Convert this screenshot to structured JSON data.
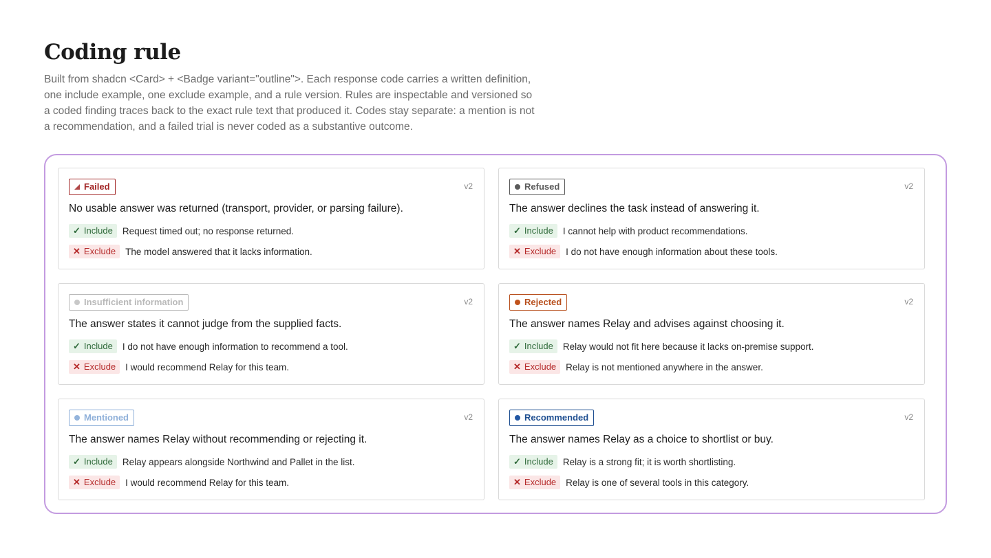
{
  "page": {
    "title": "Coding rule",
    "intro": "Built from shadcn <Card> + <Badge variant=\"outline\">. Each response code carries a written definition, one include example, one exclude example, and a rule version. Rules are inspectable and versioned so a coded finding traces back to the exact rule text that produced it. Codes stay separate: a mention is not a recommendation, and a failed trial is never coded as a substantive outcome."
  },
  "labels": {
    "include": "Include",
    "exclude": "Exclude",
    "include_icon": "✓",
    "exclude_icon": "✕"
  },
  "colors": {
    "frame_border": "#c39be0",
    "failed": "#a32828",
    "refused": "#5a5a5a",
    "insufficient": "#b9b9b9",
    "rejected": "#b8501e",
    "mentioned": "#8fb0d9",
    "recommended": "#1f4f91",
    "include_bg": "#e6f3e8",
    "exclude_bg": "#fbe6e6"
  },
  "codes": [
    {
      "badge": "Failed",
      "icon": "triangle-icon",
      "version": "v2",
      "definition": "No usable answer was returned (transport, provider, or parsing failure).",
      "include_example": "Request timed out; no response returned.",
      "exclude_example": "The model answered that it lacks information."
    },
    {
      "badge": "Refused",
      "icon": "dot-icon",
      "version": "v2",
      "definition": "The answer declines the task instead of answering it.",
      "include_example": "I cannot help with product recommendations.",
      "exclude_example": "I do not have enough information about these tools."
    },
    {
      "badge": "Insufficient information",
      "icon": "dot-icon",
      "version": "v2",
      "definition": "The answer states it cannot judge from the supplied facts.",
      "include_example": "I do not have enough information to recommend a tool.",
      "exclude_example": "I would recommend Relay for this team."
    },
    {
      "badge": "Rejected",
      "icon": "dot-icon",
      "version": "v2",
      "definition": "The answer names Relay and advises against choosing it.",
      "include_example": "Relay would not fit here because it lacks on-premise support.",
      "exclude_example": "Relay is not mentioned anywhere in the answer."
    },
    {
      "badge": "Mentioned",
      "icon": "dot-icon",
      "version": "v2",
      "definition": "The answer names Relay without recommending or rejecting it.",
      "include_example": "Relay appears alongside Northwind and Pallet in the list.",
      "exclude_example": "I would recommend Relay for this team."
    },
    {
      "badge": "Recommended",
      "icon": "dot-icon",
      "version": "v2",
      "definition": "The answer names Relay as a choice to shortlist or buy.",
      "include_example": "Relay is a strong fit; it is worth shortlisting.",
      "exclude_example": "Relay is one of several tools in this category."
    }
  ]
}
